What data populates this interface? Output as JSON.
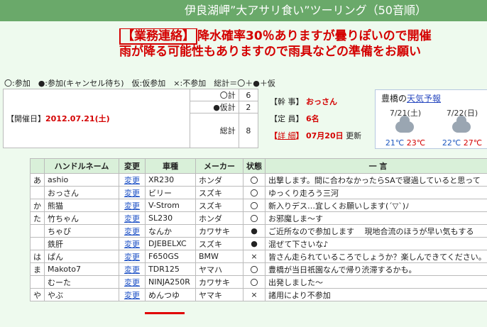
{
  "title": "伊良湖岬”大アサリ食い”ツーリング（50音順）",
  "notice": {
    "tag": "【業務連絡】",
    "line1_rest": "降水確率30％ありますが曇りぽいので開催",
    "line2": "雨が降る可能性もありますので雨具などの準備をお願い"
  },
  "legend": "〇:参加　●:参加(キャンセル待ち)　仮:仮参加　×:不参加　総計＝〇＋●＋仮",
  "summary": {
    "circle_label": "〇計",
    "circle_value": "6",
    "tentative_label": "●仮計",
    "tentative_value": "2",
    "date_label": "【開催日】",
    "date_value": "2012.07.21(土)",
    "total_label": "総計",
    "total_value": "8"
  },
  "meta": {
    "organizer_label": "【幹 事】",
    "organizer_value": "おっさん",
    "capacity_label": "【定 員】",
    "capacity_value": "6名",
    "detail_open": "【",
    "detail_link": "詳 細",
    "detail_close": "】",
    "update_date": "07月20日",
    "update_suffix": "更新"
  },
  "weather": {
    "city": "豊橋の",
    "link": "天気予報",
    "days": [
      {
        "date": "7/21(土)",
        "icon": "cloud-icon",
        "hi": "21℃",
        "lo": "23℃"
      },
      {
        "date": "7/22(日)",
        "icon": "cloud-icon",
        "hi": "22℃",
        "lo": "27℃"
      }
    ]
  },
  "table": {
    "headers": [
      "",
      "ハンドルネーム",
      "変更",
      "車種",
      "メーカー",
      "状態",
      "一 言"
    ],
    "rows": [
      {
        "kana": "あ",
        "name": "ashio",
        "edit": "変更",
        "model": "XR230",
        "maker": "ホンダ",
        "state": "〇",
        "comment": "出撃します。間に合わなかったらSAで寝過していると思って"
      },
      {
        "kana": "",
        "name": "おっさん",
        "edit": "変更",
        "model": "ビリー",
        "maker": "スズキ",
        "state": "〇",
        "comment": "ゆっくり走ろう三河"
      },
      {
        "kana": "か",
        "name": "熊猫",
        "edit": "変更",
        "model": "V-Strom",
        "maker": "スズキ",
        "state": "〇",
        "comment": "新入りデス…宜しくお願いします(´▽`)ﾉ"
      },
      {
        "kana": "た",
        "name": "竹ちゃん",
        "edit": "変更",
        "model": "SL230",
        "maker": "ホンダ",
        "state": "〇",
        "comment": "お邪魔しま〜す"
      },
      {
        "kana": "",
        "name": "ちゃび",
        "edit": "変更",
        "model": "なんか",
        "maker": "カワサキ",
        "state": "●",
        "comment": "ご近所なので参加します　 現地合流のほうが早い気もする"
      },
      {
        "kana": "",
        "name": "鉄肝",
        "edit": "変更",
        "model": "DJEBELXC",
        "maker": "スズキ",
        "state": "●",
        "comment": "混ぜて下さいな♪"
      },
      {
        "kana": "は",
        "name": "ぱん",
        "edit": "変更",
        "model": "F650GS",
        "maker": "BMW",
        "state": "×",
        "comment": "皆さん走られているころでしょうか？楽しんできてください。"
      },
      {
        "kana": "ま",
        "name": "Makoto7",
        "edit": "変更",
        "model": "TDR125",
        "maker": "ヤマハ",
        "state": "〇",
        "comment": "豊橋が当日祇園なんで帰り渋滞するかも。"
      },
      {
        "kana": "",
        "name": "むーた",
        "edit": "変更",
        "model": "NINJA250R",
        "maker": "カワサキ",
        "state": "〇",
        "comment": "出発しました〜"
      },
      {
        "kana": "や",
        "name": "やぶ",
        "edit": "変更",
        "model": "めんつゆ",
        "maker": "ヤマキ",
        "state": "×",
        "comment": "諸用により不参加"
      }
    ]
  }
}
